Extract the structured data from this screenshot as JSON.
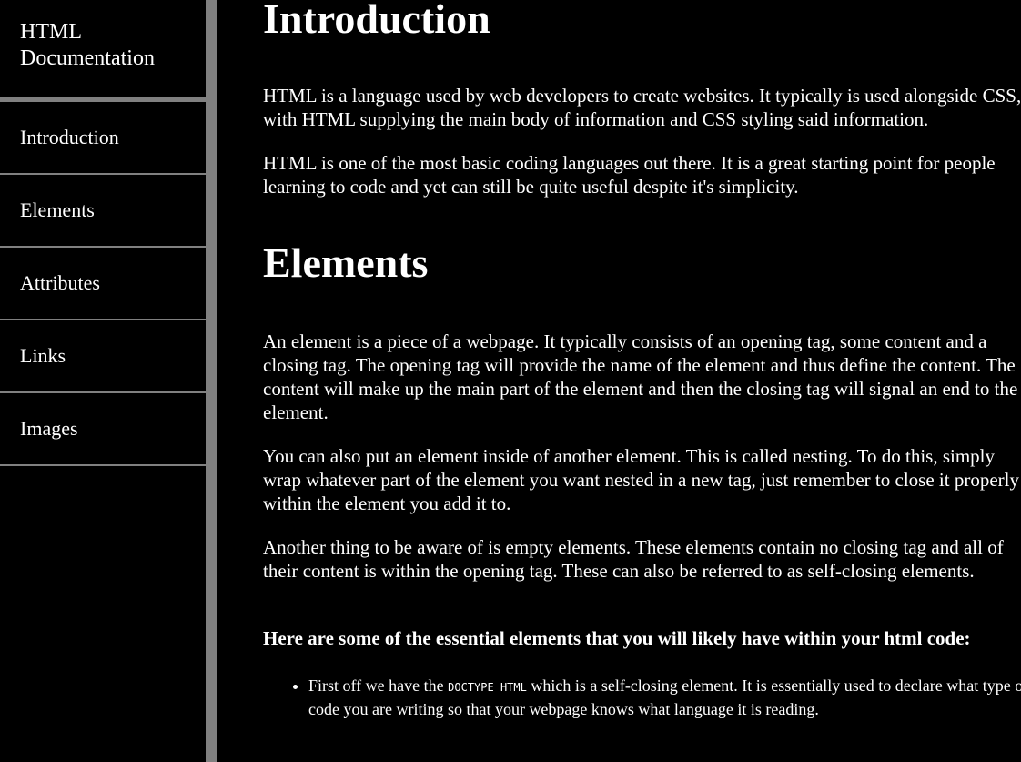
{
  "sidebar": {
    "title": "HTML Documentation",
    "items": [
      {
        "label": "Introduction"
      },
      {
        "label": "Elements"
      },
      {
        "label": "Attributes"
      },
      {
        "label": "Links"
      },
      {
        "label": "Images"
      }
    ]
  },
  "main": {
    "introduction": {
      "title": "Introduction",
      "paragraphs": [
        "HTML is a language used by web developers to create websites. It typically is used alongside CSS, with HTML supplying the main body of information and CSS styling said information.",
        "HTML is one of the most basic coding languages out there. It is a great starting point for people learning to code and yet can still be quite useful despite it's simplicity."
      ]
    },
    "elements": {
      "title": "Elements",
      "paragraphs": [
        "An element is a piece of a webpage. It typically consists of an opening tag, some content and a closing tag. The opening tag will provide the name of the element and thus define the content. The content will make up the main part of the element and then the closing tag will signal an end to the element.",
        "You can also put an element inside of another element. This is called nesting. To do this, simply wrap whatever part of the element you want nested in a new tag, just remember to close it properly within the element you add it to.",
        "Another thing to be aware of is empty elements. These elements contain no closing tag and all of their content is within the opening tag. These can also be referred to as self-closing elements."
      ],
      "essential_heading": "Here are some of the essential elements that you will likely have within your html code:",
      "list": [
        {
          "before": "First off we have the ",
          "code": "DOCTYPE HTML",
          "after": " which is a self-closing element. It is essentially used to declare what type of code you are writing so that your webpage knows what language it is reading."
        }
      ]
    }
  }
}
